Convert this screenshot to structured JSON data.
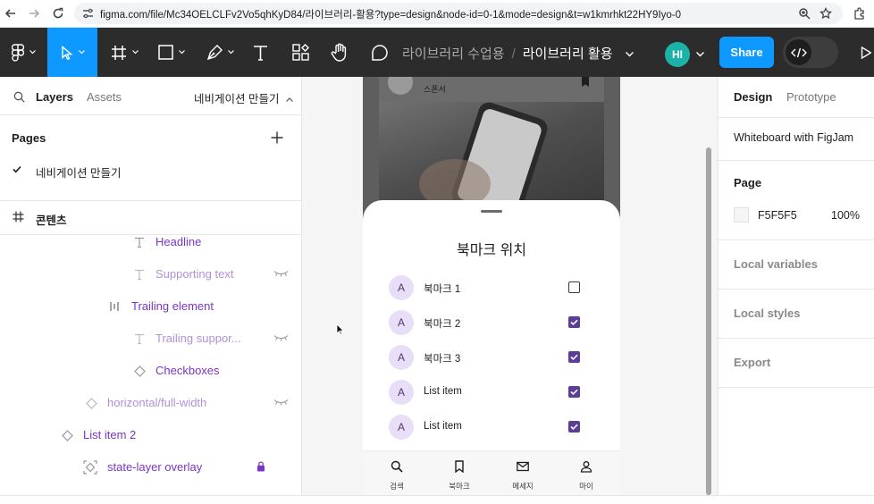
{
  "browser": {
    "url": "figma.com/file/Mc34OELCLFv2Vo5qhKyD84/라이브러리-활용?type=design&node-id=0-1&mode=design&t=w1kmrhkt22HY9Iyo-0"
  },
  "toolbar": {
    "project": "라이브러리 수업용",
    "separator": "/",
    "file": "라이브러리 활용",
    "avatar_initials": "HI",
    "share_label": "Share"
  },
  "left_panel": {
    "tab_layers": "Layers",
    "tab_assets": "Assets",
    "current_page": "네비게이션 만들기",
    "pages_heading": "Pages",
    "pages": [
      {
        "label": "네비게이션 만들기",
        "selected": true
      }
    ],
    "frame_name": "콘텐츠",
    "layers": [
      {
        "label": "Headline",
        "icon": "text-icon",
        "state": "normal"
      },
      {
        "label": "Supporting text",
        "icon": "text-icon",
        "state": "hidden"
      },
      {
        "label": "Trailing element",
        "icon": "auto-layout-icon",
        "state": "normal"
      },
      {
        "label": "Trailing suppor...",
        "icon": "text-icon",
        "state": "hidden"
      },
      {
        "label": "Checkboxes",
        "icon": "instance-icon",
        "state": "normal"
      },
      {
        "label": "horizontal/full-width",
        "icon": "instance-icon",
        "state": "hidden"
      },
      {
        "label": "List item 2",
        "icon": "instance-icon",
        "state": "normal"
      },
      {
        "label": "state-layer overlay",
        "icon": "component-frame-icon",
        "state": "locked"
      }
    ]
  },
  "canvas": {
    "card_caption": "스폰서",
    "sheet_title": "북마크 위치",
    "list": [
      {
        "avatar": "A",
        "label": "북마크 1",
        "checked": false
      },
      {
        "avatar": "A",
        "label": "북마크 2",
        "checked": true
      },
      {
        "avatar": "A",
        "label": "북마크 3",
        "checked": true
      },
      {
        "avatar": "A",
        "label": "List item",
        "checked": true
      },
      {
        "avatar": "A",
        "label": "List item",
        "checked": true
      }
    ],
    "bottom_nav": [
      {
        "label": "검색",
        "icon": "search-icon"
      },
      {
        "label": "북마크",
        "icon": "bookmark-icon"
      },
      {
        "label": "메세지",
        "icon": "mail-icon"
      },
      {
        "label": "마이",
        "icon": "person-icon"
      }
    ]
  },
  "right_panel": {
    "tab_design": "Design",
    "tab_prototype": "Prototype",
    "file_name": "Whiteboard with FigJam",
    "page_heading": "Page",
    "page_color": "F5F5F5",
    "page_opacity": "100%",
    "local_variables": "Local variables",
    "local_styles": "Local styles",
    "export": "Export"
  },
  "colors": {
    "accent_purple": "#7b35c7",
    "share_blue": "#0d99ff",
    "toolbar_dark": "#2c2c2c",
    "checkbox_purple": "#5c3e97",
    "avatar_lilac": "#e8def8"
  }
}
